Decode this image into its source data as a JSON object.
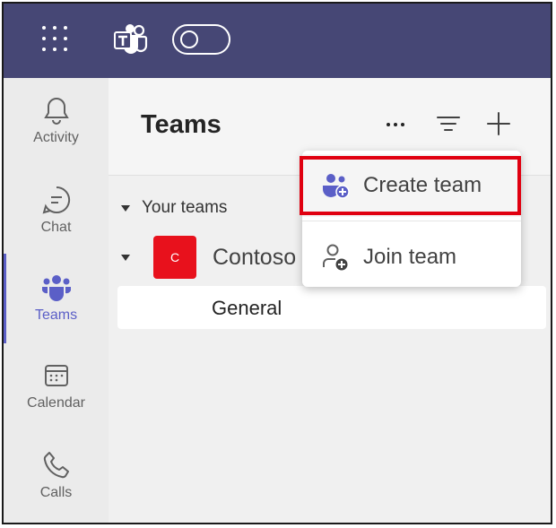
{
  "top_bar": {
    "app_icon": "teams-logo-icon",
    "menu_icon": "app-launcher-icon",
    "toggle_state": "off",
    "accent_color": "#464775"
  },
  "rail": {
    "items": [
      {
        "label": "Activity",
        "icon": "bell-icon"
      },
      {
        "label": "Chat",
        "icon": "chat-icon"
      },
      {
        "label": "Teams",
        "icon": "teams-icon",
        "active": true
      },
      {
        "label": "Calendar",
        "icon": "calendar-icon"
      },
      {
        "label": "Calls",
        "icon": "phone-icon"
      }
    ],
    "active_color": "#5b5fc7"
  },
  "pane": {
    "title": "Teams",
    "section_label": "Your teams",
    "team": {
      "initial": "C",
      "name": "Contoso",
      "avatar_color": "#e8111c"
    },
    "channel": "General"
  },
  "menu": {
    "items": [
      {
        "label": "Create team",
        "icon": "create-team-icon",
        "highlighted": true
      },
      {
        "label": "Join team",
        "icon": "join-team-icon"
      }
    ],
    "highlight_color": "#e00010"
  }
}
